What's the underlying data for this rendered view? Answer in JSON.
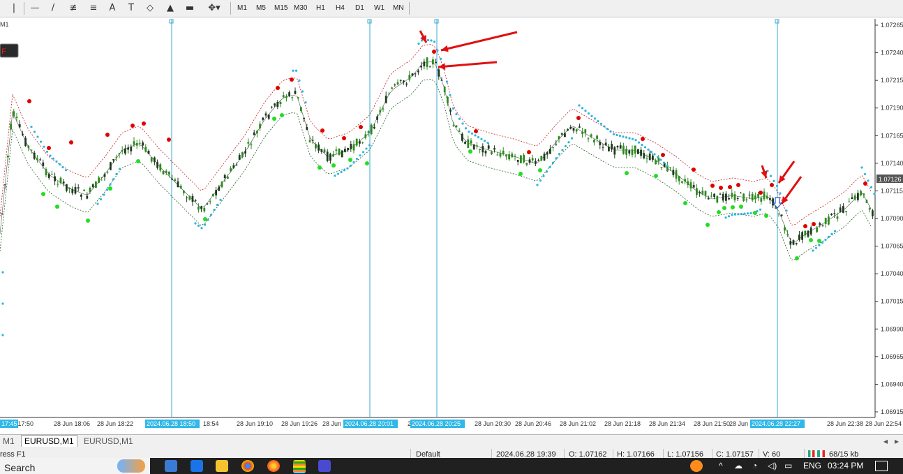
{
  "toolbar": {
    "tools": [
      {
        "name": "cursor-icon",
        "glyph": "|"
      },
      {
        "name": "hline-icon",
        "glyph": "—"
      },
      {
        "name": "trendline-icon",
        "glyph": "/"
      },
      {
        "name": "channel-icon",
        "glyph": "≢"
      },
      {
        "name": "fibo-icon",
        "glyph": "≡"
      },
      {
        "name": "text-icon",
        "glyph": "A"
      },
      {
        "name": "label-icon",
        "glyph": "T"
      },
      {
        "name": "shapes-icon",
        "glyph": "◇"
      },
      {
        "name": "arrow-up-icon",
        "glyph": "▲"
      },
      {
        "name": "rectangle-icon",
        "glyph": "▬"
      },
      {
        "name": "more-objects-icon",
        "glyph": "✥▾"
      }
    ],
    "timeframes": [
      "M1",
      "M5",
      "M15",
      "M30",
      "H1",
      "H4",
      "D1",
      "W1",
      "MN"
    ]
  },
  "chart": {
    "tf_label": "M1",
    "badge": "F",
    "current_price": "1.07126",
    "prices": [
      "1.07265",
      "1.07240",
      "1.07215",
      "1.07190",
      "1.07165",
      "1.07140",
      "1.07115",
      "1.07090",
      "1.07065",
      "1.07040",
      "1.07015",
      "1.06990",
      "1.06965",
      "1.06940",
      "1.06915"
    ],
    "time_labels": [
      "n 17:50",
      "28 Jun 18:06",
      "28 Jun 18:22",
      "18:54",
      "28 Jun 19:10",
      "28 Jun 19:26",
      "28 Jun 19:4",
      "2",
      "28 Jun 20:30",
      "28 Jun 20:46",
      "28 Jun 21:02",
      "28 Jun 21:18",
      "28 Jun 21:34",
      "28 Jun 21:50",
      "28 Jun 22:0",
      "28 Jun 22:38",
      "28 Jun 22:54"
    ],
    "crosshair_labels": [
      "17:45",
      "2024.06.28 18:50",
      "2024.06.28 20:01",
      "2024.06.28 20:25",
      "2024.06.28 22:27"
    ],
    "colors": {
      "bull": "#2e8b20",
      "bear": "#1e3a1e",
      "sar": "#2cb5e0",
      "dot_red": "#e00000",
      "dot_green": "#22dd22",
      "arrow": "#e01010",
      "vline": "#3aa8d0"
    }
  },
  "tabs": [
    "M1",
    "EURUSD,M1",
    "EURUSD,M1"
  ],
  "status": {
    "help": "ress F1",
    "profile": "Default",
    "datetime": "2024.06.28 19:39",
    "open": "O: 1.07162",
    "high": "H: 1.07166",
    "low": "L: 1.07156",
    "close": "C: 1.07157",
    "volume": "V: 60",
    "traffic": "68/15 kb"
  },
  "taskbar": {
    "search": "Search",
    "lang": "ENG",
    "time": "03:24 PM"
  }
}
